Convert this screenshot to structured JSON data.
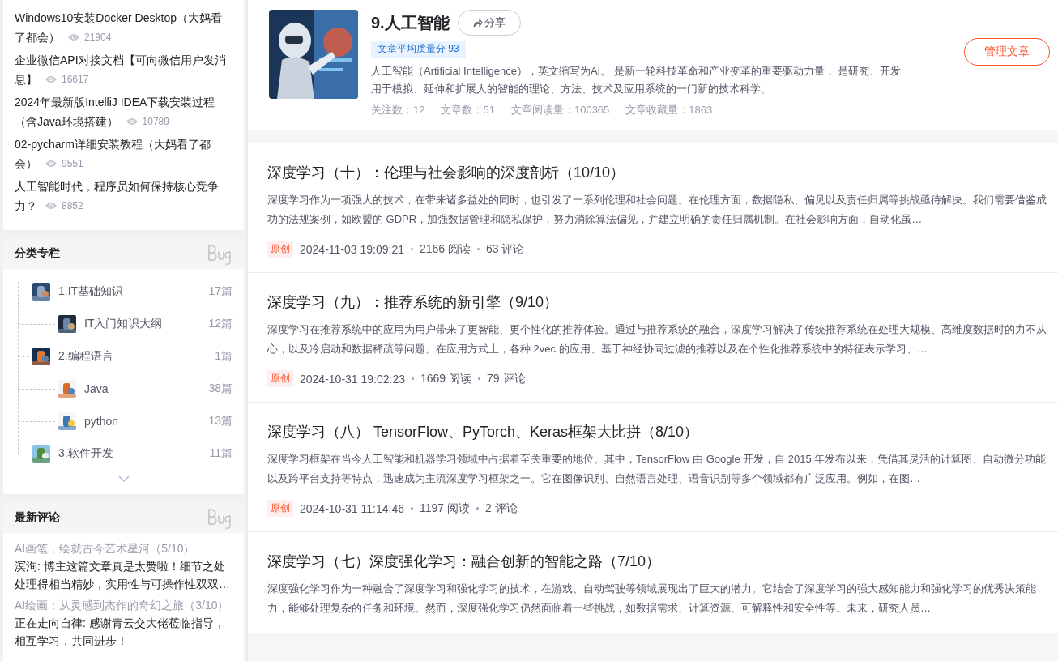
{
  "hot_articles": [
    {
      "title": "Windows10安装Docker Desktop（大妈看了都会）",
      "views": "21904"
    },
    {
      "title": "企业微信API对接文档【可向微信用户发消息】",
      "views": "16617"
    },
    {
      "title": "2024年最新版IntelliJ IDEA下载安装过程（含Java环境搭建）",
      "views": "10789"
    },
    {
      "title": "02-pycharm详细安装教程（大妈看了都会）",
      "views": "9551"
    },
    {
      "title": "人工智能时代，程序员如何保持核心竞争力？",
      "views": "8852"
    }
  ],
  "categories": {
    "title": "分类专栏",
    "items": [
      {
        "name": "1.IT基础知识",
        "count": "17篇",
        "children": [
          {
            "name": "IT入门知识大纲",
            "count": "12篇"
          }
        ]
      },
      {
        "name": "2.编程语言",
        "count": "1篇",
        "children": [
          {
            "name": "Java",
            "count": "38篇"
          },
          {
            "name": "python",
            "count": "13篇"
          }
        ]
      },
      {
        "name": "3.软件开发",
        "count": "11篇"
      }
    ]
  },
  "comments": {
    "title": "最新评论",
    "items": [
      {
        "article": "AI画笔，绘就古今艺术星河（5/10）",
        "text": "溟洵: 博主这篇文章真是太赞啦！细节之处处理得相当精妙，实用性与可操作性双双…"
      },
      {
        "article": "AI绘画：从灵感到杰作的奇幻之旅（3/10）",
        "text": "正在走向自律: 感谢青云交大佬莅临指导，相互学习，共同进步！"
      }
    ]
  },
  "column": {
    "title": "9.人工智能",
    "share": "分享",
    "quality": "文章平均质量分 93",
    "description": "人工智能（Artificial Intelligence），英文缩写为AI。 是新一轮科技革命和产业变革的重要驱动力量， 是研究、开发用于模拟、延伸和扩展人的智能的理论、方法、技术及应用系统的一门新的技术科学。",
    "stats": [
      "关注数：12",
      "文章数：51",
      "文章阅读量：100365",
      "文章收藏量：1863"
    ],
    "manage": "管理文章"
  },
  "articles": [
    {
      "title": "深度学习（十）：伦理与社会影响的深度剖析（10/10）",
      "summary": "深度学习作为一项强大的技术，在带来诸多益处的同时，也引发了一系列伦理和社会问题。在伦理方面，数据隐私、偏见以及责任归属等挑战亟待解决。我们需要借鉴成功的法规案例，如欧盟的 GDPR，加强数据管理和隐私保护，努力消除算法偏见，并建立明确的责任归属机制。在社会影响方面，自动化虽…",
      "tag": "原创",
      "date": "2024-11-03 19:09:21",
      "reads": "2166 阅读",
      "comments": "63 评论"
    },
    {
      "title": "深度学习（九）：推荐系统的新引擎（9/10）",
      "summary": "深度学习在推荐系统中的应用为用户带来了更智能、更个性化的推荐体验。通过与推荐系统的融合，深度学习解决了传统推荐系统在处理大规模、高维度数据时的力不从心，以及冷启动和数据稀疏等问题。在应用方式上，各种 2vec 的应用、基于神经协同过滤的推荐以及在个性化推荐系统中的特征表示学习、…",
      "tag": "原创",
      "date": "2024-10-31 19:02:23",
      "reads": "1669 阅读",
      "comments": "79 评论"
    },
    {
      "title": "深度学习（八） TensorFlow、PyTorch、Keras框架大比拼（8/10）",
      "summary": "深度学习框架在当今人工智能和机器学习领域中占据着至关重要的地位。其中，TensorFlow 由 Google 开发，自 2015 年发布以来，凭借其灵活的计算图、自动微分功能以及跨平台支持等特点，迅速成为主流深度学习框架之一。它在图像识别、自然语言处理、语音识别等多个领域都有广泛应用。例如，在图…",
      "tag": "原创",
      "date": "2024-10-31 11:14:46",
      "reads": "1197 阅读",
      "comments": "2 评论"
    },
    {
      "title": "深度学习（七）深度强化学习：融合创新的智能之路（7/10）",
      "summary": "深度强化学习作为一种融合了深度学习和强化学习的技术，在游戏、自动驾驶等领域展现出了巨大的潜力。它结合了深度学习的强大感知能力和强化学习的优秀决策能力，能够处理复杂的任务和环境。然而，深度强化学习仍然面临着一些挑战，如数据需求、计算资源、可解释性和安全性等。未来，研究人员…"
    }
  ]
}
